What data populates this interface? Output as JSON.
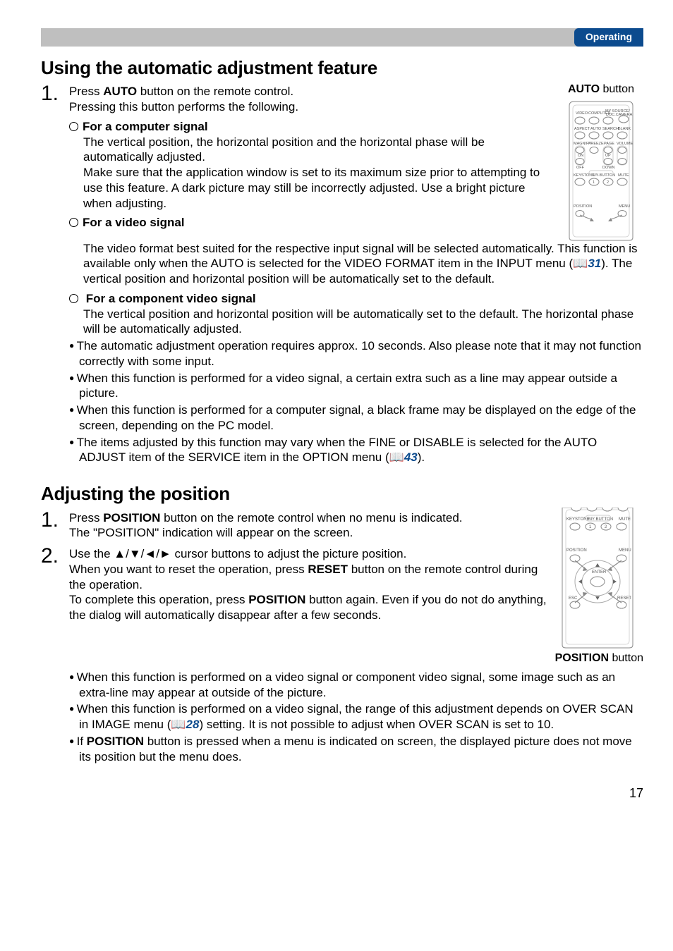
{
  "header": {
    "badge": "Operating"
  },
  "section1": {
    "title": "Using the automatic adjustment feature",
    "float_caption_prefix": "AUTO",
    "float_caption_suffix": " button",
    "step1_num": "1.",
    "step1_line1a": "Press ",
    "step1_line1b": "AUTO",
    "step1_line1c": " button on the remote control.",
    "step1_line2": "Pressing this button performs the following.",
    "sub1_title": "For a computer signal",
    "sub1_body": "The vertical position, the horizontal position and the horizontal phase will be automatically adjusted.\nMake sure that the application window is set to its maximum size prior to attempting to use this feature. A dark picture may still be incorrectly adjusted. Use a bright picture when adjusting.",
    "sub2_title": "For a video signal",
    "sub2_body_a": "The video format best suited for the respective input signal will be selected automatically. This function is available only when the AUTO is selected for the VIDEO FORMAT item in the INPUT menu (",
    "sub2_ref": "31",
    "sub2_body_b": "). The vertical position and horizontal position will be automatically set to the default.",
    "sub3_title": " For a component video signal",
    "sub3_body": "The vertical position and horizontal position will be automatically set to the default. The horizontal phase will be automatically adjusted.",
    "b1": "The automatic adjustment operation requires approx. 10 seconds. Also please note that it may not function correctly with some input.",
    "b2": "When this function is performed for a video signal, a certain extra such as a line may appear outside a picture.",
    "b3": "When this function is performed for a computer signal, a black frame may be displayed on the edge of the screen, depending on the PC model.",
    "b4a": "The items adjusted by this function may vary when the FINE or DISABLE is selected for the AUTO ADJUST item of the SERVICE item in the OPTION menu (",
    "b4ref": "43",
    "b4b": ")."
  },
  "section2": {
    "title": "Adjusting the position",
    "float_caption_prefix": "POSITION",
    "float_caption_suffix": " button",
    "s1_num": "1.",
    "s1a": "Press ",
    "s1b": "POSITION",
    "s1c": " button on the remote control when no menu is indicated.",
    "s1d": "The \"POSITION\" indication will appear on the screen.",
    "s2_num": "2.",
    "s2a": "Use the ▲/▼/◄/► cursor buttons to adjust the picture position.",
    "s2b": "When you want to reset the operation, press ",
    "s2c": "RESET",
    "s2d": " button on the remote control during the operation.",
    "s2e": "To complete this operation, press ",
    "s2f": "POSITION",
    "s2g": " button again. Even if you do not do anything, the dialog will automatically disappear after a few seconds.",
    "b1": "When this function is performed on a video signal or component video signal, some image such as an extra-line may appear at outside of the picture.",
    "b2a": "When this function is performed on a video signal, the range of this adjustment depends on OVER SCAN in IMAGE menu  (",
    "b2ref": "28",
    "b2b": ") setting. It is not possible to adjust when OVER SCAN is set to 10.",
    "b3a": "If ",
    "b3b": "POSITION",
    "b3c": " button is pressed when a menu is indicated on screen, the displayed picture does not move its position but the menu does."
  },
  "remote_labels": {
    "r1": [
      "VIDEO",
      "COMPUTER",
      "MY SOURCE/",
      "DOC.CAMERA"
    ],
    "r2": [
      "ASPECT",
      "AUTO",
      "SEARCH",
      "BLANK"
    ],
    "r3": [
      "MAGNIFY",
      "FREEZE",
      "PAGE",
      "VOLUME"
    ],
    "r3b": [
      "ON",
      "UP"
    ],
    "r3c": [
      "OFF",
      "DOWN"
    ],
    "r4": [
      "KEYSTONE",
      "MY BUTTON",
      "MUTE"
    ],
    "r4n": [
      "1",
      "2"
    ],
    "r5": [
      "POSITION",
      "MENU"
    ],
    "r6": [
      "ESC",
      "ENTER",
      "RESET"
    ]
  },
  "page_number": "17"
}
